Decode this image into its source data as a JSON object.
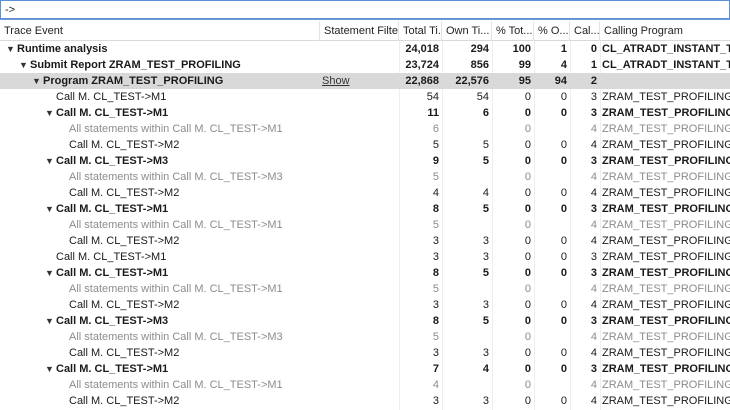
{
  "filter": {
    "value": "->"
  },
  "columns": {
    "event": "Trace Event",
    "filter": "Statement Filter",
    "total": "Total Ti...",
    "own": "Own Ti...",
    "pct_total": "% Tot...",
    "pct_own": "% O...",
    "calls": "Cal...",
    "caller": "Calling Program"
  },
  "rows": [
    {
      "level": 0,
      "expand": "open",
      "event": "Runtime analysis",
      "filter": "",
      "total": "24,018",
      "own": "294",
      "pct_total": "100",
      "pct_own": "1",
      "calls": "0",
      "caller": "CL_ATRADT_INSTANT_TRA",
      "bold": true,
      "dim": false
    },
    {
      "level": 1,
      "expand": "open",
      "event": "Submit Report  ZRAM_TEST_PROFILING",
      "filter": "",
      "total": "23,724",
      "own": "856",
      "pct_total": "99",
      "pct_own": "4",
      "calls": "1",
      "caller": "CL_ATRADT_INSTANT_TRA",
      "bold": true,
      "dim": false
    },
    {
      "level": 2,
      "expand": "open",
      "event": "Program  ZRAM_TEST_PROFILING",
      "filter": "Show",
      "total": "22,868",
      "own": "22,576",
      "pct_total": "95",
      "pct_own": "94",
      "calls": "2",
      "caller": "",
      "bold": true,
      "dim": false,
      "selected": true
    },
    {
      "level": 3,
      "expand": "",
      "event": "Call M.  CL_TEST->M1",
      "filter": "",
      "total": "54",
      "own": "54",
      "pct_total": "0",
      "pct_own": "0",
      "calls": "3",
      "caller": "ZRAM_TEST_PROFILING",
      "bold": false,
      "dim": false
    },
    {
      "level": 3,
      "expand": "open",
      "event": "Call M.  CL_TEST->M1",
      "filter": "",
      "total": "11",
      "own": "6",
      "pct_total": "0",
      "pct_own": "0",
      "calls": "3",
      "caller": "ZRAM_TEST_PROFILING",
      "bold": true,
      "dim": false
    },
    {
      "level": 4,
      "expand": "",
      "event": "All statements within Call M.  CL_TEST->M1",
      "filter": "",
      "total": "6",
      "own": "",
      "pct_total": "0",
      "pct_own": "",
      "calls": "4",
      "caller": "ZRAM_TEST_PROFILING",
      "bold": false,
      "dim": true
    },
    {
      "level": 4,
      "expand": "",
      "event": "Call M.  CL_TEST->M2",
      "filter": "",
      "total": "5",
      "own": "5",
      "pct_total": "0",
      "pct_own": "0",
      "calls": "4",
      "caller": "ZRAM_TEST_PROFILING",
      "bold": false,
      "dim": false
    },
    {
      "level": 3,
      "expand": "open",
      "event": "Call M.  CL_TEST->M3",
      "filter": "",
      "total": "9",
      "own": "5",
      "pct_total": "0",
      "pct_own": "0",
      "calls": "3",
      "caller": "ZRAM_TEST_PROFILING",
      "bold": true,
      "dim": false
    },
    {
      "level": 4,
      "expand": "",
      "event": "All statements within Call M.  CL_TEST->M3",
      "filter": "",
      "total": "5",
      "own": "",
      "pct_total": "0",
      "pct_own": "",
      "calls": "4",
      "caller": "ZRAM_TEST_PROFILING",
      "bold": false,
      "dim": true
    },
    {
      "level": 4,
      "expand": "",
      "event": "Call M.  CL_TEST->M2",
      "filter": "",
      "total": "4",
      "own": "4",
      "pct_total": "0",
      "pct_own": "0",
      "calls": "4",
      "caller": "ZRAM_TEST_PROFILING",
      "bold": false,
      "dim": false
    },
    {
      "level": 3,
      "expand": "open",
      "event": "Call M.  CL_TEST->M1",
      "filter": "",
      "total": "8",
      "own": "5",
      "pct_total": "0",
      "pct_own": "0",
      "calls": "3",
      "caller": "ZRAM_TEST_PROFILING",
      "bold": true,
      "dim": false
    },
    {
      "level": 4,
      "expand": "",
      "event": "All statements within Call M.  CL_TEST->M1",
      "filter": "",
      "total": "5",
      "own": "",
      "pct_total": "0",
      "pct_own": "",
      "calls": "4",
      "caller": "ZRAM_TEST_PROFILING",
      "bold": false,
      "dim": true
    },
    {
      "level": 4,
      "expand": "",
      "event": "Call M.  CL_TEST->M2",
      "filter": "",
      "total": "3",
      "own": "3",
      "pct_total": "0",
      "pct_own": "0",
      "calls": "4",
      "caller": "ZRAM_TEST_PROFILING",
      "bold": false,
      "dim": false
    },
    {
      "level": 3,
      "expand": "",
      "event": "Call M.  CL_TEST->M1",
      "filter": "",
      "total": "3",
      "own": "3",
      "pct_total": "0",
      "pct_own": "0",
      "calls": "3",
      "caller": "ZRAM_TEST_PROFILING",
      "bold": false,
      "dim": false
    },
    {
      "level": 3,
      "expand": "open",
      "event": "Call M.  CL_TEST->M1",
      "filter": "",
      "total": "8",
      "own": "5",
      "pct_total": "0",
      "pct_own": "0",
      "calls": "3",
      "caller": "ZRAM_TEST_PROFILING",
      "bold": true,
      "dim": false
    },
    {
      "level": 4,
      "expand": "",
      "event": "All statements within Call M.  CL_TEST->M1",
      "filter": "",
      "total": "5",
      "own": "",
      "pct_total": "0",
      "pct_own": "",
      "calls": "4",
      "caller": "ZRAM_TEST_PROFILING",
      "bold": false,
      "dim": true
    },
    {
      "level": 4,
      "expand": "",
      "event": "Call M.  CL_TEST->M2",
      "filter": "",
      "total": "3",
      "own": "3",
      "pct_total": "0",
      "pct_own": "0",
      "calls": "4",
      "caller": "ZRAM_TEST_PROFILING",
      "bold": false,
      "dim": false
    },
    {
      "level": 3,
      "expand": "open",
      "event": "Call M.  CL_TEST->M3",
      "filter": "",
      "total": "8",
      "own": "5",
      "pct_total": "0",
      "pct_own": "0",
      "calls": "3",
      "caller": "ZRAM_TEST_PROFILING",
      "bold": true,
      "dim": false
    },
    {
      "level": 4,
      "expand": "",
      "event": "All statements within Call M.  CL_TEST->M3",
      "filter": "",
      "total": "5",
      "own": "",
      "pct_total": "0",
      "pct_own": "",
      "calls": "4",
      "caller": "ZRAM_TEST_PROFILING",
      "bold": false,
      "dim": true
    },
    {
      "level": 4,
      "expand": "",
      "event": "Call M.  CL_TEST->M2",
      "filter": "",
      "total": "3",
      "own": "3",
      "pct_total": "0",
      "pct_own": "0",
      "calls": "4",
      "caller": "ZRAM_TEST_PROFILING",
      "bold": false,
      "dim": false
    },
    {
      "level": 3,
      "expand": "open",
      "event": "Call M.  CL_TEST->M1",
      "filter": "",
      "total": "7",
      "own": "4",
      "pct_total": "0",
      "pct_own": "0",
      "calls": "3",
      "caller": "ZRAM_TEST_PROFILING",
      "bold": true,
      "dim": false
    },
    {
      "level": 4,
      "expand": "",
      "event": "All statements within Call M.  CL_TEST->M1",
      "filter": "",
      "total": "4",
      "own": "",
      "pct_total": "0",
      "pct_own": "",
      "calls": "4",
      "caller": "ZRAM_TEST_PROFILING",
      "bold": false,
      "dim": true
    },
    {
      "level": 4,
      "expand": "",
      "event": "Call M.  CL_TEST->M2",
      "filter": "",
      "total": "3",
      "own": "3",
      "pct_total": "0",
      "pct_own": "0",
      "calls": "4",
      "caller": "ZRAM_TEST_PROFILING",
      "bold": false,
      "dim": false
    }
  ]
}
